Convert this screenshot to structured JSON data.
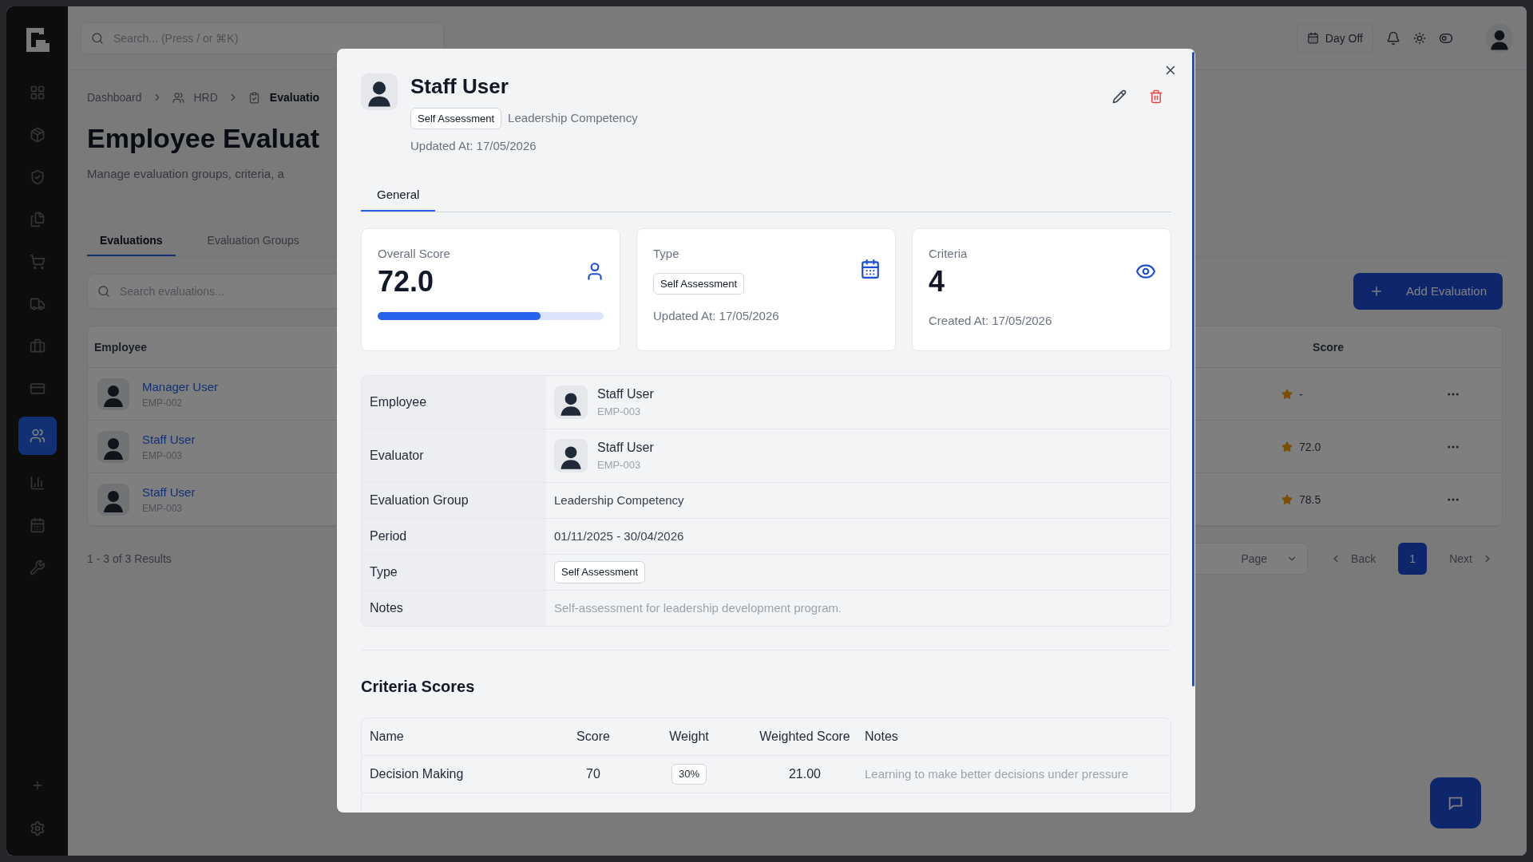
{
  "sidebar": {
    "items": [
      {
        "selected": false
      },
      {
        "selected": false
      },
      {
        "selected": false
      },
      {
        "selected": false
      },
      {
        "selected": false
      },
      {
        "selected": false
      },
      {
        "selected": false
      },
      {
        "selected": false
      },
      {
        "selected": true
      },
      {
        "selected": false
      },
      {
        "selected": false
      },
      {
        "selected": false
      }
    ]
  },
  "topbar": {
    "search_placeholder": "Search... (Press / or ⌘K)",
    "day_off": "Day Off"
  },
  "page": {
    "breadcrumb": [
      "Dashboard",
      "HRD",
      "Evaluatio"
    ],
    "title": "Employee Evaluat",
    "subtitle": "Manage evaluation groups, criteria, a",
    "tabs": [
      {
        "label": "Evaluations",
        "selected": true
      },
      {
        "label": "Evaluation Groups",
        "selected": false
      }
    ],
    "search_placeholder": "Search evaluations...",
    "add_button": "Add Evaluation",
    "table": {
      "columns": [
        "Employee",
        "Score"
      ],
      "rows": [
        {
          "name": "Manager User",
          "code": "EMP-002",
          "score": "-"
        },
        {
          "name": "Staff User",
          "code": "EMP-003",
          "score": "72.0"
        },
        {
          "name": "Staff User",
          "code": "EMP-003",
          "score": "78.5"
        }
      ]
    },
    "results": "1 - 3 of 3 Results",
    "per_page": "Page",
    "back": "Back",
    "pages": [
      {
        "label": "1",
        "selected": true
      }
    ],
    "next": "Next"
  },
  "modal": {
    "title": "Staff User",
    "type_badge": "Self Assessment",
    "group": "Leadership Competency",
    "updated_at": "Updated At: 17/05/2026",
    "tabs": [
      {
        "label": "General",
        "selected": true
      }
    ],
    "cards": [
      {
        "kind": "score",
        "label": "Overall Score",
        "value": "72.0",
        "level": 0.72
      },
      {
        "kind": "type",
        "label": "Type",
        "badge": "Self Assessment",
        "footnote": "Updated At: 17/05/2026"
      },
      {
        "kind": "count",
        "label": "Criteria",
        "value": "4",
        "footnote": "Created At: 17/05/2026"
      }
    ],
    "details": [
      {
        "kind": "person",
        "label": "Employee",
        "name": "Staff User",
        "code": "EMP-003"
      },
      {
        "kind": "person",
        "label": "Evaluator",
        "name": "Staff User",
        "code": "EMP-003"
      },
      {
        "kind": "text",
        "label": "Evaluation Group",
        "value": "Leadership Competency"
      },
      {
        "kind": "text",
        "label": "Period",
        "value": "01/11/2025 - 30/04/2026"
      },
      {
        "kind": "badge",
        "label": "Type",
        "value": "Self Assessment"
      },
      {
        "kind": "note",
        "label": "Notes",
        "value": "Self-assessment for leadership development program."
      }
    ],
    "criteria": {
      "title": "Criteria Scores",
      "columns": [
        "Name",
        "Score",
        "Weight",
        "Weighted Score",
        "Notes"
      ],
      "rows": [
        {
          "name": "Decision Making",
          "score": "70",
          "weight": "30%",
          "weighted": "21.00",
          "notes": "Learning to make better decisions under pressure"
        }
      ]
    }
  }
}
